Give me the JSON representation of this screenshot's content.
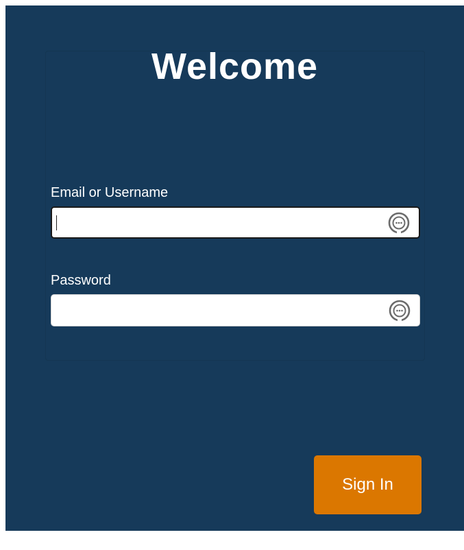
{
  "login": {
    "title": "Welcome",
    "email_label": "Email or Username",
    "email_value": "",
    "password_label": "Password",
    "password_value": "",
    "field_icon": "password-manager-icon",
    "signin_label": "Sign In"
  },
  "colors": {
    "background": "#163a5a",
    "button": "#db7700",
    "text": "#ffffff"
  }
}
